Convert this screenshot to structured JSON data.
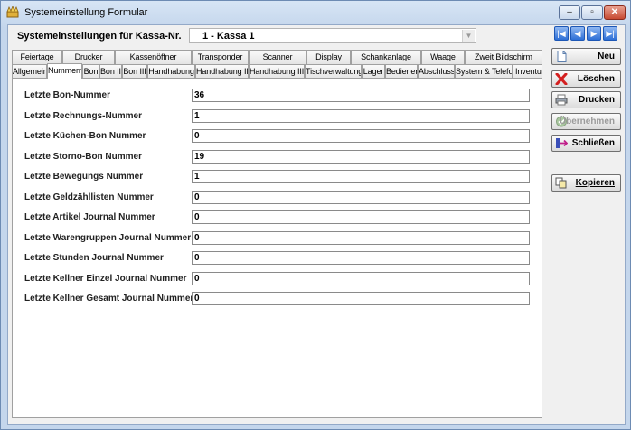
{
  "window": {
    "title": "Systemeinstellung Formular",
    "minimize": "–",
    "maximize": "▫",
    "close": "✕"
  },
  "header": {
    "kassa_label": "Systemeinstellungen für Kassa-Nr.",
    "kassa_value": "1 - Kassa 1",
    "select_arrow": "▼"
  },
  "nav": {
    "first": "|◀",
    "prev": "◀",
    "next": "▶",
    "last": "▶|"
  },
  "tabs_top": [
    "Feiertage",
    "Drucker",
    "Kassenöffner",
    "Transponder",
    "Scanner",
    "Display",
    "Schankanlage",
    "Waage",
    "Zweit Bildschirm"
  ],
  "tabs_bottom": [
    "Allgemein",
    "Nummern",
    "Bon",
    "Bon II",
    "Bon III",
    "Handhabung",
    "Handhabung II",
    "Handhabung III",
    "Tischverwaltung",
    "Lager",
    "Bediener",
    "Abschluss",
    "System & Telefon",
    "Inventur"
  ],
  "active_tab": "Nummern",
  "fields": [
    {
      "label": "Letzte Bon-Nummer",
      "value": "36"
    },
    {
      "label": "Letzte Rechnungs-Nummer",
      "value": "1"
    },
    {
      "label": "Letzte Küchen-Bon Nummer",
      "value": "0"
    },
    {
      "label": "Letzte Storno-Bon Nummer",
      "value": "19"
    },
    {
      "label": "Letzte Bewegungs Nummer",
      "value": "1"
    },
    {
      "label": "Letzte Geldzähllisten Nummer",
      "value": "0"
    },
    {
      "label": "Letzte Artikel Journal Nummer",
      "value": "0"
    },
    {
      "label": "Letzte Warengruppen Journal Nummer",
      "value": "0"
    },
    {
      "label": "Letzte Stunden Journal Nummer",
      "value": "0"
    },
    {
      "label": "Letzte Kellner Einzel Journal Nummer",
      "value": "0"
    },
    {
      "label": "Letzte Kellner Gesamt Journal Nummer",
      "value": "0"
    }
  ],
  "actions": {
    "neu": "Neu",
    "loeschen": "Löschen",
    "drucken": "Drucken",
    "uebernehmen": "Übernehmen",
    "schliessen": "Schließen",
    "kopieren": "Kopieren"
  },
  "colors": {
    "nav_blue": "#2d6fd6",
    "delete_red": "#d42020",
    "close_red": "#c74a32"
  }
}
